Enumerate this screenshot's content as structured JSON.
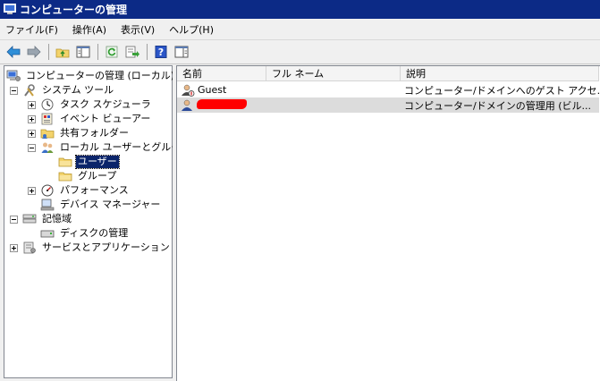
{
  "window": {
    "title": "コンピューターの管理"
  },
  "menu": [
    {
      "label": "ファイル(F)"
    },
    {
      "label": "操作(A)"
    },
    {
      "label": "表示(V)"
    },
    {
      "label": "ヘルプ(H)"
    }
  ],
  "toolbar": {
    "buttons": [
      "back-icon",
      "forward-icon",
      "up-folder-icon",
      "show-hide-tree-icon",
      "refresh-icon",
      "export-list-icon",
      "help-icon",
      "show-hide-action-pane-icon"
    ]
  },
  "tree": {
    "root": "コンピューターの管理 (ローカル)",
    "system_tools": "システム ツール",
    "task_scheduler": "タスク スケジューラ",
    "event_viewer": "イベント ビューアー",
    "shared_folders": "共有フォルダー",
    "local_users_groups": "ローカル ユーザーとグループ",
    "users": "ユーザー",
    "groups": "グループ",
    "performance": "パフォーマンス",
    "device_manager": "デバイス マネージャー",
    "storage": "記憶域",
    "disk_management": "ディスクの管理",
    "services_apps": "サービスとアプリケーション"
  },
  "list": {
    "columns": {
      "name": "名前",
      "full_name": "フル ネーム",
      "description": "説明"
    },
    "rows": [
      {
        "name": "Guest",
        "full_name": "",
        "description": "コンピューター/ドメインへのゲスト アクセ..."
      },
      {
        "name": "",
        "full_name": "",
        "description": "コンピューター/ドメインの管理用 (ビル..."
      }
    ]
  },
  "colors": {
    "title_bar": "#0c2a86",
    "selection": "#0a246a",
    "redaction": "#ff0000"
  }
}
